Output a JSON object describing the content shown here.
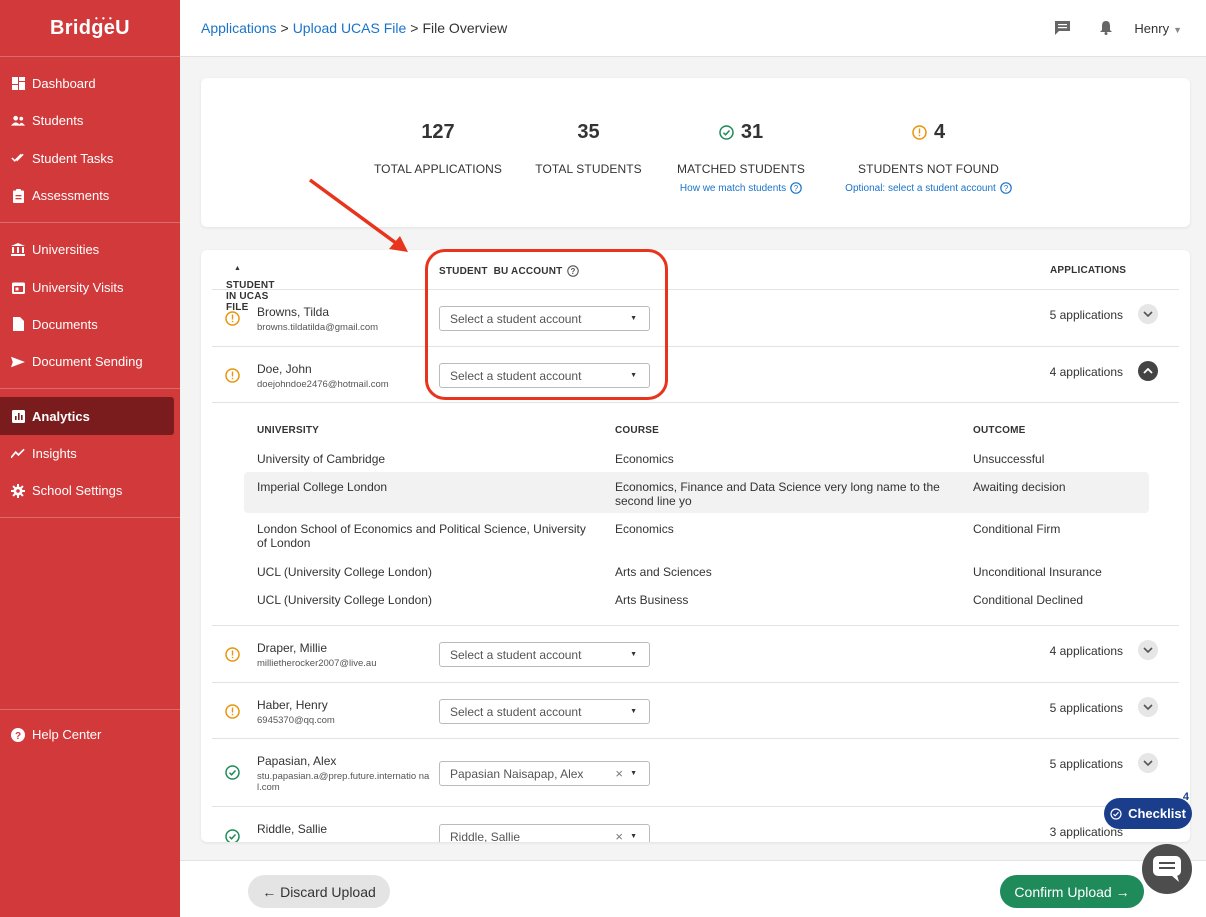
{
  "brand": {
    "name": "BridgeU",
    "color": "#d2393b"
  },
  "sidebar": {
    "items": [
      {
        "label": "Dashboard",
        "icon": "dashboard-icon"
      },
      {
        "label": "Students",
        "icon": "students-icon"
      },
      {
        "label": "Student Tasks",
        "icon": "tasks-check-icon"
      },
      {
        "label": "Assessments",
        "icon": "clipboard-icon"
      },
      {
        "label": "Universities",
        "icon": "university-icon"
      },
      {
        "label": "University Visits",
        "icon": "calendar-icon"
      },
      {
        "label": "Documents",
        "icon": "document-icon"
      },
      {
        "label": "Document Sending",
        "icon": "send-icon"
      },
      {
        "label": "Analytics",
        "icon": "analytics-icon",
        "active": true
      },
      {
        "label": "Insights",
        "icon": "insights-icon"
      },
      {
        "label": "School Settings",
        "icon": "gear-icon"
      }
    ],
    "help": "Help Center"
  },
  "header": {
    "breadcrumb": [
      "Applications",
      "Upload UCAS File",
      "File Overview"
    ],
    "user": "Henry"
  },
  "summary": {
    "total_applications": {
      "value": "127",
      "label": "TOTAL APPLICATIONS"
    },
    "total_students": {
      "value": "35",
      "label": "TOTAL STUDENTS"
    },
    "matched_students": {
      "value": "31",
      "label": "MATCHED STUDENTS",
      "link": "How we match students"
    },
    "not_found": {
      "value": "4",
      "label": "STUDENTS NOT FOUND",
      "link": "Optional: select a student account"
    }
  },
  "table": {
    "headers": {
      "student": "STUDENT IN UCAS FILE",
      "account": "STUDENT  BU ACCOUNT",
      "applications": "APPLICATIONS"
    },
    "rows": [
      {
        "name": "Browns, Tilda",
        "email": "browns.tildatilda@gmail.com",
        "status": "warning",
        "account": "Select a student account",
        "apps": "5 applications"
      },
      {
        "name": "Doe, John",
        "email": "doejohndoe2476@hotmail.com",
        "status": "warning",
        "account": "Select a student account",
        "apps": "4 applications",
        "expanded": true
      },
      {
        "name": "Draper, Millie",
        "email": "millietherocker2007@live.au",
        "status": "warning",
        "account": "Select a student account",
        "apps": "4 applications"
      },
      {
        "name": "Haber, Henry",
        "email": "6945370@qq.com",
        "status": "warning",
        "account": "Select a student account",
        "apps": "5 applications"
      },
      {
        "name": "Papasian, Alex",
        "email": "stu.papasian.a@prep.future.internatio nal.com",
        "status": "matched",
        "account": "Papasian Naisapap, Alex",
        "apps": "5 applications"
      },
      {
        "name": "Riddle, Sallie",
        "email": "",
        "status": "matched",
        "account": "Riddle, Sallie",
        "apps": "3 applications"
      }
    ],
    "detail": {
      "headers": {
        "university": "UNIVERSITY",
        "course": "COURSE",
        "outcome": "OUTCOME"
      },
      "rows": [
        {
          "university": "University of Cambridge",
          "course": "Economics",
          "outcome": "Unsuccessful"
        },
        {
          "university": "Imperial College London",
          "course": "Economics, Finance and Data Science very long name to the second line yo",
          "outcome": "Awaiting decision"
        },
        {
          "university": "London School of Economics and Political Science, University of London",
          "course": "Economics",
          "outcome": "Conditional Firm"
        },
        {
          "university": "UCL (University College London)",
          "course": "Arts and Sciences",
          "outcome": "Unconditional Insurance"
        },
        {
          "university": "UCL (University College London)",
          "course": "Arts Business",
          "outcome": "Conditional Declined"
        }
      ]
    }
  },
  "footer": {
    "discard": "← Discard Upload",
    "confirm": "Confirm Upload →"
  },
  "checklist": {
    "label": "Checklist",
    "count": "4"
  },
  "colors": {
    "accent": "#1a73c9",
    "warning": "#e8940c",
    "matched": "#1f8a5a",
    "annotation": "#e8341c"
  }
}
